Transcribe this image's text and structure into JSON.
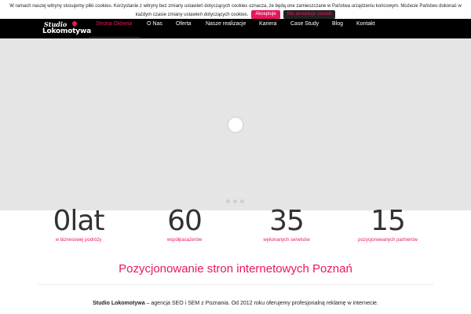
{
  "cookie_bar": {
    "line1": "W ramach naszej witryny stosujemy pliki cookies. Korzystanie z witryny bez zmiany ustawień dotyczących cookies oznacza, że będą one zamieszczane w Państwa urządzeniu końcowym. Możecie Państwo dokonać w",
    "line2": "każdym czasie zmiany ustawień dotyczących cookies.",
    "accept_label": "Akceptuje",
    "decline_label": "Nie akceptuje ciastek"
  },
  "logo": {
    "line1": "Studio",
    "line2": "Lokomotywa"
  },
  "nav": {
    "items": [
      {
        "label": "Strona Główna"
      },
      {
        "label": "O Nas"
      },
      {
        "label": "Oferta"
      },
      {
        "label": "Nasze realizacje"
      },
      {
        "label": "Kariera"
      },
      {
        "label": "Case Study"
      },
      {
        "label": "Blog"
      },
      {
        "label": "Kontakt"
      }
    ]
  },
  "stats": [
    {
      "value": "0lat",
      "label": "w biznesowej podróży"
    },
    {
      "value": "60",
      "label": "współpasażerów"
    },
    {
      "value": "35",
      "label": "wykonanych serwisów"
    },
    {
      "value": "15",
      "label": "pozycjonowanych partnerów"
    }
  ],
  "headline": "Pozycjonowanie stron internetowych Poznań",
  "intro": {
    "brand": "Studio Lokomotywa",
    "text": " – agencja SEO i SEM z Poznania. Od 2012 roku oferujemy profesjonalną reklamę w internecie."
  },
  "colors": {
    "accent": "#e8175d",
    "nav_bg": "#000000",
    "slider_bg": "#e5e5e5"
  }
}
